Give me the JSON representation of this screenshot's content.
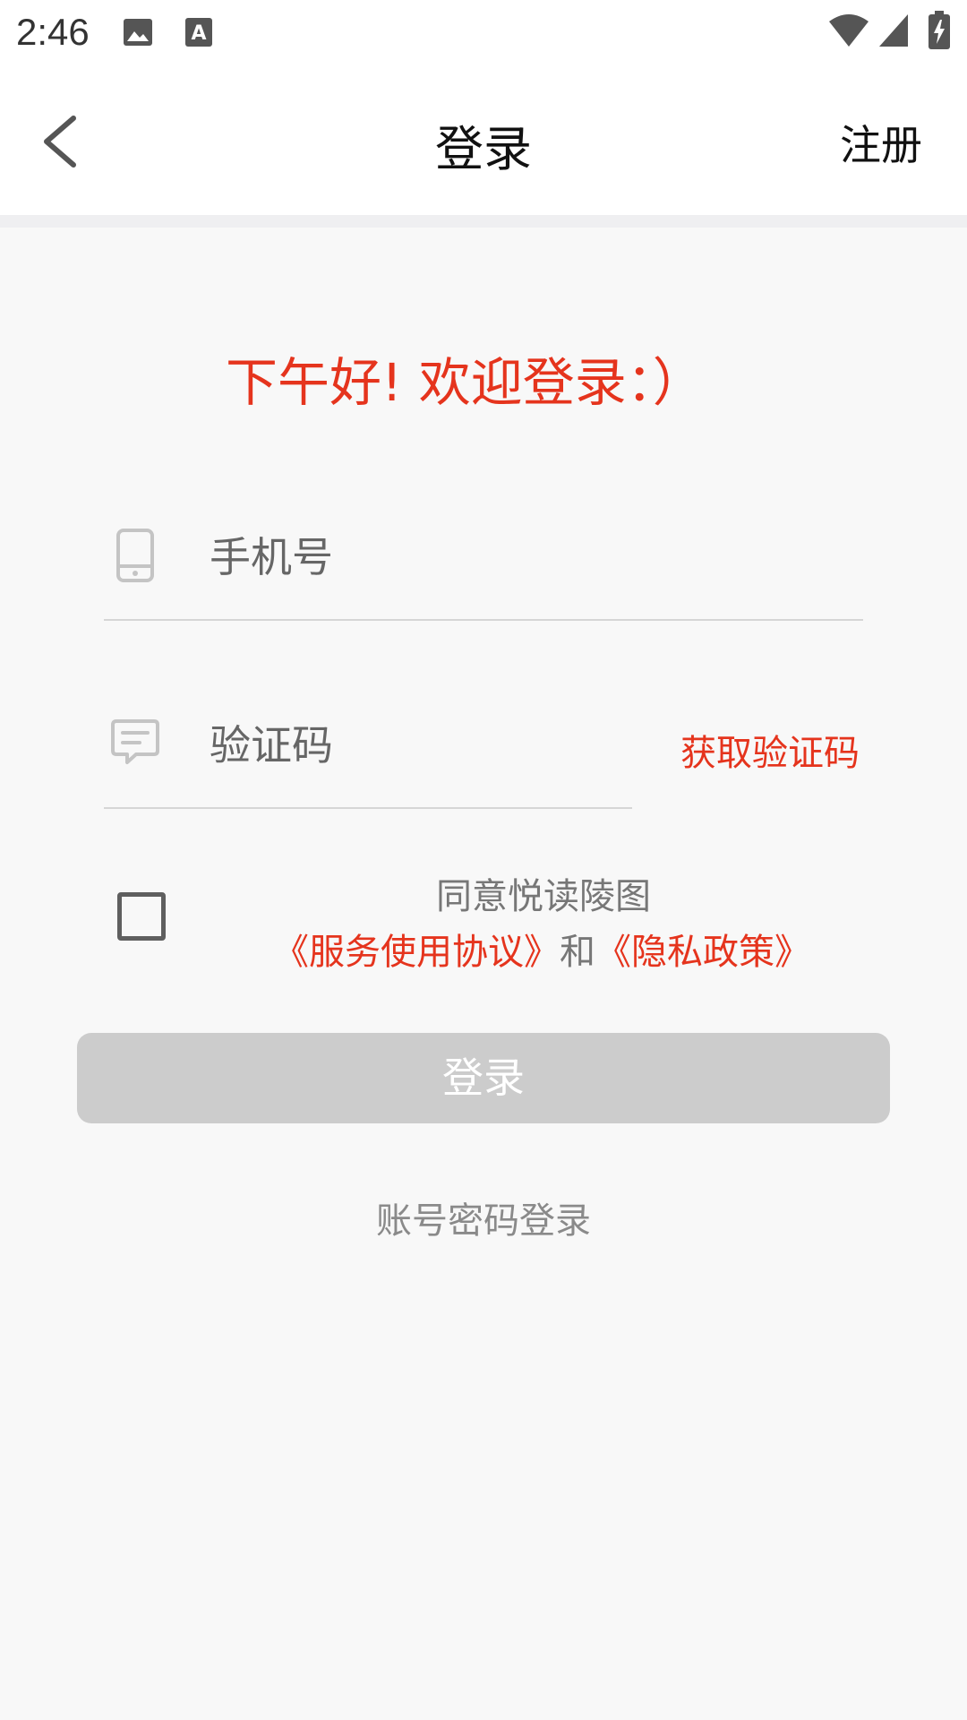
{
  "status_bar": {
    "time": "2:46",
    "icons": [
      "image-icon",
      "a-notification-icon",
      "wifi-icon",
      "signal-icon",
      "battery-charging-icon"
    ]
  },
  "header": {
    "title": "登录",
    "register_label": "注册",
    "back_icon": "chevron-left-icon"
  },
  "welcome_text": "下午好! 欢迎登录：）",
  "form": {
    "phone": {
      "icon": "phone-icon",
      "placeholder": "手机号",
      "value": ""
    },
    "code": {
      "icon": "message-icon",
      "placeholder": "验证码",
      "value": "",
      "get_code_label": "获取验证码"
    }
  },
  "agreement": {
    "checked": false,
    "line1": "同意悦读陵图",
    "service_link": "《服务使用协议》",
    "and_text": "和",
    "privacy_link": "《隐私政策》"
  },
  "login_button": "登录",
  "account_login_label": "账号密码登录",
  "colors": {
    "accent": "#e5341d",
    "button_disabled": "#cccccc",
    "background": "#f8f8f8"
  }
}
